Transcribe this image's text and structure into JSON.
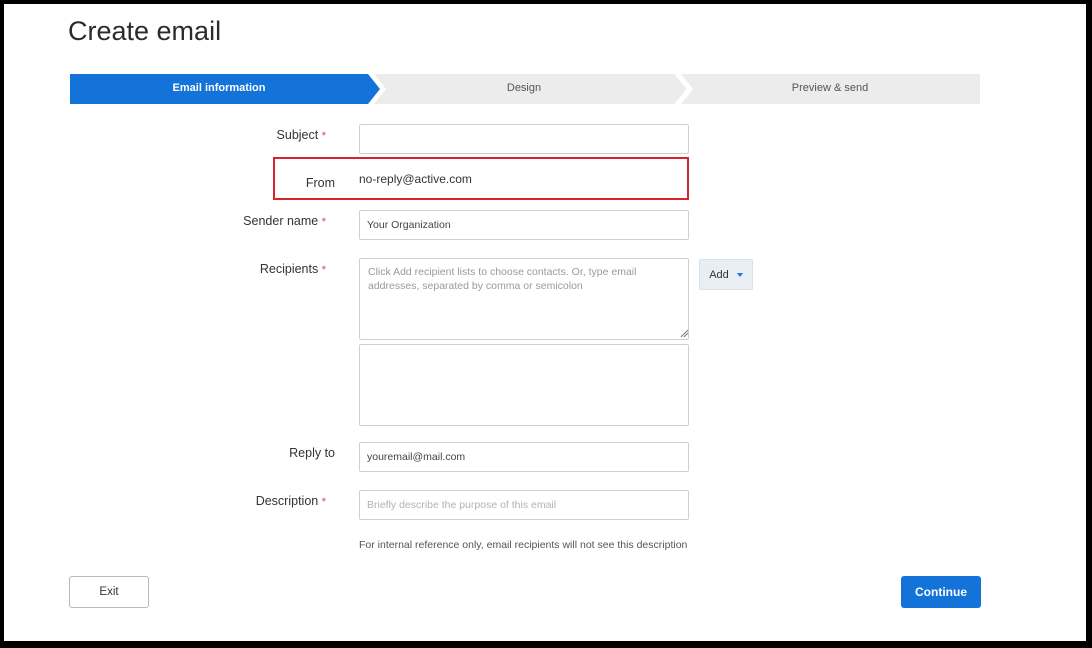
{
  "page": {
    "title": "Create email"
  },
  "stepper": {
    "steps": [
      {
        "label": "Email information",
        "active": true
      },
      {
        "label": "Design",
        "active": false
      },
      {
        "label": "Preview & send",
        "active": false
      }
    ]
  },
  "form": {
    "required_marker": "*",
    "subject": {
      "label": "Subject",
      "value": "",
      "placeholder": ""
    },
    "from": {
      "label": "From",
      "value": "no-reply@active.com"
    },
    "sender_name": {
      "label": "Sender name",
      "value": "Your Organization"
    },
    "recipients": {
      "label": "Recipients",
      "placeholder": "Click Add recipient lists to choose contacts. Or, type email addresses, separated by comma or semicolon",
      "add_label": "Add"
    },
    "reply_to": {
      "label": "Reply to",
      "value": "youremail@mail.com"
    },
    "description": {
      "label": "Description",
      "placeholder": "Briefly describe the purpose of this email",
      "hint": "For internal reference only, email recipients will not see this description"
    }
  },
  "actions": {
    "exit_label": "Exit",
    "continue_label": "Continue"
  },
  "colors": {
    "accent": "#1473d8",
    "required": "#e0413a",
    "highlight": "#d8232a",
    "step_inactive": "#ececec"
  },
  "icons": {
    "add_dropdown": "caret-down-icon",
    "resize": "resize-grip-icon"
  }
}
